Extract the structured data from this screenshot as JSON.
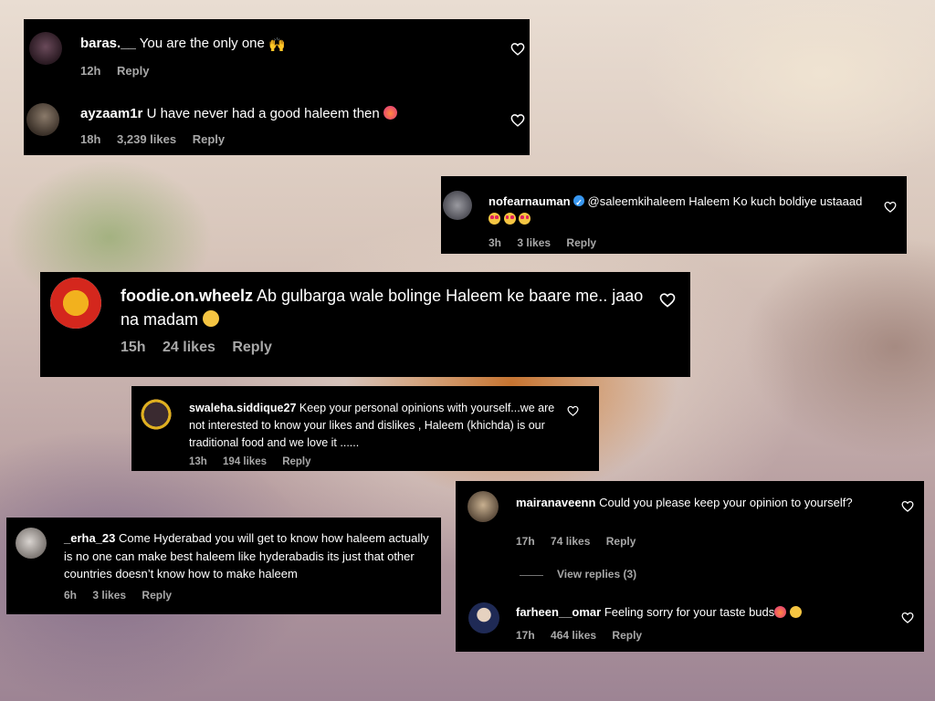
{
  "comments": [
    {
      "username": "baras.__",
      "text": "You are the only one",
      "emoji": "raising-hands",
      "time": "12h",
      "likes": "",
      "reply": "Reply"
    },
    {
      "username": "ayzaam1r",
      "text": "U have never had a good haleem then",
      "emoji": "angry-face",
      "time": "18h",
      "likes": "3,239 likes",
      "reply": "Reply"
    },
    {
      "username": "nofearnauman",
      "verified": true,
      "text": "@saleemkihaleem Haleem Ko kuch boldiye ustaaad",
      "emoji": "heart-eyes x3",
      "time": "3h",
      "likes": "3 likes",
      "reply": "Reply"
    },
    {
      "username": "foodie.on.wheelz",
      "text": "Ab gulbarga wale bolinge Haleem ke baare me.. jaao na madam",
      "emoji": "sad-face",
      "time": "15h",
      "likes": "24 likes",
      "reply": "Reply"
    },
    {
      "username": "swaleha.siddique27",
      "text": "Keep your personal opinions with yourself...we are not interested to know your likes and dislikes , Haleem (khichda) is our traditional food and we love it ......",
      "time": "13h",
      "likes": "194 likes",
      "reply": "Reply"
    },
    {
      "username": "mairanaveenn",
      "text": "Could you please keep your opinion to yourself?",
      "time": "17h",
      "likes": "74 likes",
      "reply": "Reply",
      "view_replies": "View replies (3)"
    },
    {
      "username": "_erha_23",
      "text": "Come Hyderabad you will get to know how haleem actually is no one can make best haleem like hyderabadis its just that other countries doesn’t know how to make haleem",
      "time": "6h",
      "likes": "3 likes",
      "reply": "Reply"
    },
    {
      "username": "farheen__omar",
      "text": "Feeling sorry for your taste buds",
      "emoji": "angry-face, rolling-laughing",
      "time": "17h",
      "likes": "464 likes",
      "reply": "Reply"
    }
  ],
  "icons": {
    "like": "heart-outline-icon",
    "verified": "verified-badge-icon"
  },
  "colors": {
    "card_bg": "#000000",
    "text": "#ffffff",
    "meta": "#a8a8a8",
    "verified": "#3897f0"
  }
}
